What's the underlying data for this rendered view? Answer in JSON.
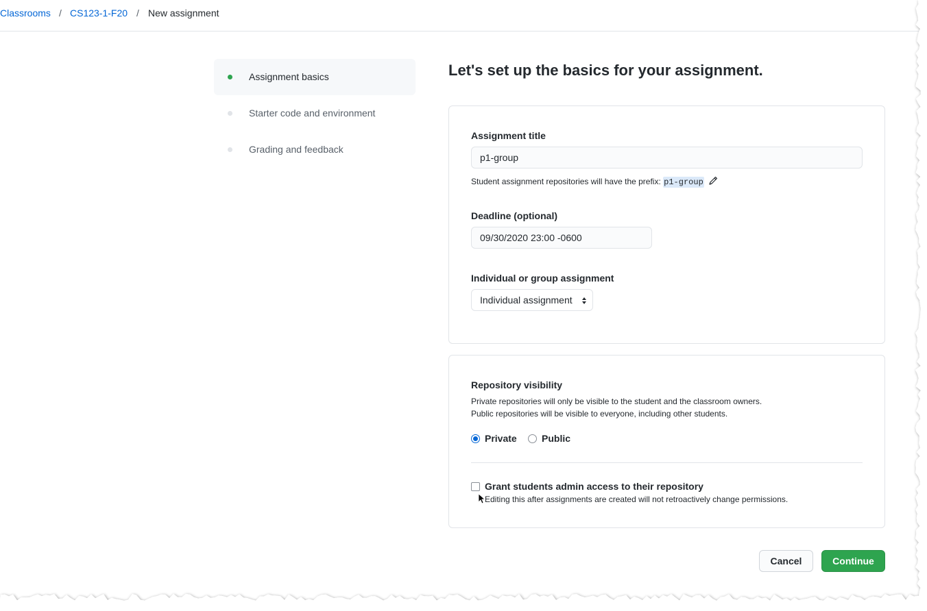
{
  "breadcrumb": {
    "items": [
      "Classrooms",
      "CS123-1-F20"
    ],
    "separator": "/",
    "current": "New assignment"
  },
  "steps": [
    {
      "label": "Assignment basics",
      "active": true
    },
    {
      "label": "Starter code and environment",
      "active": false
    },
    {
      "label": "Grading and feedback",
      "active": false
    }
  ],
  "page_title": "Let's set up the basics for your assignment.",
  "basics": {
    "title_label": "Assignment title",
    "title_value": "p1-group",
    "prefix_text": "Student assignment repositories will have the prefix:",
    "prefix_value": "p1-group",
    "edit_icon": "pencil-icon",
    "deadline_label": "Deadline (optional)",
    "deadline_value": "09/30/2020 23:00 -0600",
    "type_label": "Individual or group assignment",
    "type_selected": "Individual assignment"
  },
  "visibility": {
    "label": "Repository visibility",
    "desc_line1": "Private repositories will only be visible to the student and the classroom owners.",
    "desc_line2": "Public repositories will be visible to everyone, including other students.",
    "options": [
      {
        "label": "Private",
        "checked": true
      },
      {
        "label": "Public",
        "checked": false
      }
    ],
    "admin_label": "Grant students admin access to their repository",
    "admin_checked": false,
    "admin_hint": "Editing this after assignments are created will not retroactively change permissions."
  },
  "actions": {
    "cancel": "Cancel",
    "continue": "Continue"
  },
  "colors": {
    "link": "#0366d6",
    "active_dot": "#2ea44f",
    "primary_button": "#2ea44f",
    "radio_checked": "#0366d6"
  }
}
